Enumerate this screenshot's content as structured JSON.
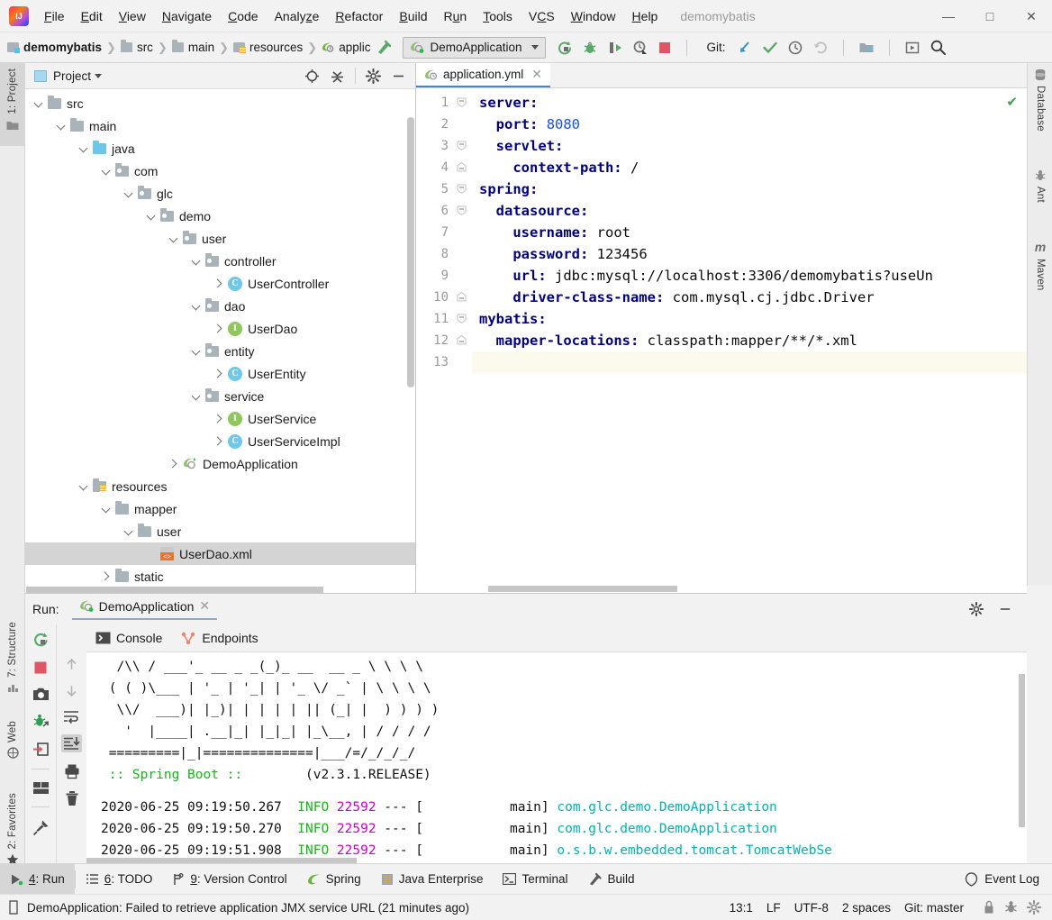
{
  "window": {
    "title": "demomybatis",
    "controls": {
      "minimize": "—",
      "maximize": "□",
      "close": "✕"
    }
  },
  "menu": [
    {
      "label": "File"
    },
    {
      "label": "Edit"
    },
    {
      "label": "View"
    },
    {
      "label": "Navigate"
    },
    {
      "label": "Code"
    },
    {
      "label": "Analyze"
    },
    {
      "label": "Refactor"
    },
    {
      "label": "Build"
    },
    {
      "label": "Run"
    },
    {
      "label": "Tools"
    },
    {
      "label": "VCS"
    },
    {
      "label": "Window"
    },
    {
      "label": "Help"
    }
  ],
  "navbar": {
    "breadcrumbs": [
      {
        "label": "demomybatis",
        "icon": "module-icon"
      },
      {
        "label": "src",
        "icon": "folder-icon"
      },
      {
        "label": "main",
        "icon": "folder-icon"
      },
      {
        "label": "resources",
        "icon": "resources-folder-icon"
      },
      {
        "label": "applic",
        "icon": "spring-file-icon"
      }
    ],
    "run_config": "DemoApplication",
    "git_label": "Git:",
    "actions": [
      "run-button",
      "debug-button",
      "run-with-coverage-button",
      "profile-button",
      "stop-button",
      "update-project-button",
      "commit-button",
      "history-button",
      "rollback-button",
      "project-structure-button",
      "run-anything-button",
      "search-everywhere-button"
    ]
  },
  "left_stripe": [
    {
      "label": "1: Project",
      "active": true
    },
    {
      "label": "7: Structure",
      "active": false
    },
    {
      "label": "Web",
      "active": false
    },
    {
      "label": "2: Favorites",
      "active": false
    }
  ],
  "right_stripe": [
    {
      "label": "Database"
    },
    {
      "label": "Ant"
    },
    {
      "label": "Maven"
    }
  ],
  "project_panel": {
    "title": "Project",
    "actions": [
      "locate-icon",
      "collapse-all-icon",
      "gear-icon",
      "hide-icon"
    ],
    "tree": [
      {
        "label": "src",
        "depth": 1,
        "arrow": "down",
        "icon": "folder",
        "selected": false
      },
      {
        "label": "main",
        "depth": 2,
        "arrow": "down",
        "icon": "folder",
        "selected": false
      },
      {
        "label": "java",
        "depth": 3,
        "arrow": "down",
        "icon": "java",
        "selected": false
      },
      {
        "label": "com",
        "depth": 4,
        "arrow": "down",
        "icon": "pkg",
        "selected": false
      },
      {
        "label": "glc",
        "depth": 5,
        "arrow": "down",
        "icon": "pkg",
        "selected": false
      },
      {
        "label": "demo",
        "depth": 6,
        "arrow": "down",
        "icon": "pkg",
        "selected": false
      },
      {
        "label": "user",
        "depth": 7,
        "arrow": "down",
        "icon": "pkg",
        "selected": false
      },
      {
        "label": "controller",
        "depth": 8,
        "arrow": "down",
        "icon": "pkg",
        "selected": false
      },
      {
        "label": "UserController",
        "depth": 9,
        "arrow": "right",
        "icon": "class",
        "selected": false
      },
      {
        "label": "dao",
        "depth": 8,
        "arrow": "down",
        "icon": "pkg",
        "selected": false
      },
      {
        "label": "UserDao",
        "depth": 9,
        "arrow": "right",
        "icon": "iface",
        "selected": false
      },
      {
        "label": "entity",
        "depth": 8,
        "arrow": "down",
        "icon": "pkg",
        "selected": false
      },
      {
        "label": "UserEntity",
        "depth": 9,
        "arrow": "right",
        "icon": "class",
        "selected": false
      },
      {
        "label": "service",
        "depth": 8,
        "arrow": "down",
        "icon": "pkg",
        "selected": false
      },
      {
        "label": "UserService",
        "depth": 9,
        "arrow": "right",
        "icon": "iface",
        "selected": false
      },
      {
        "label": "UserServiceImpl",
        "depth": 9,
        "arrow": "right",
        "icon": "class",
        "selected": false
      },
      {
        "label": "DemoApplication",
        "depth": 7,
        "arrow": "right",
        "icon": "spring",
        "selected": false
      },
      {
        "label": "resources",
        "depth": 3,
        "arrow": "down",
        "icon": "res",
        "selected": false
      },
      {
        "label": "mapper",
        "depth": 4,
        "arrow": "down",
        "icon": "folder",
        "selected": false
      },
      {
        "label": "user",
        "depth": 5,
        "arrow": "down",
        "icon": "folder",
        "selected": false
      },
      {
        "label": "UserDao.xml",
        "depth": 6,
        "arrow": "none",
        "icon": "xml",
        "selected": true
      },
      {
        "label": "static",
        "depth": 4,
        "arrow": "right",
        "icon": "folder",
        "selected": false
      }
    ]
  },
  "editor": {
    "tab": {
      "label": "application.yml",
      "icon": "spring-file-icon",
      "close": "✕"
    },
    "inspection_status": "✔",
    "lines": [
      {
        "no": "1",
        "fold": "minus-top",
        "indent": 0,
        "key": "server:",
        "value": "",
        "value_type": "none",
        "current": false
      },
      {
        "no": "2",
        "fold": "",
        "indent": 1,
        "key": "port:",
        "value": "8080",
        "value_type": "number",
        "current": false
      },
      {
        "no": "3",
        "fold": "minus-top",
        "indent": 1,
        "key": "servlet:",
        "value": "",
        "value_type": "none",
        "current": false
      },
      {
        "no": "4",
        "fold": "minus-end",
        "indent": 2,
        "key": "context-path:",
        "value": "/",
        "value_type": "text",
        "current": false
      },
      {
        "no": "5",
        "fold": "minus-top",
        "indent": 0,
        "key": "spring:",
        "value": "",
        "value_type": "none",
        "current": false
      },
      {
        "no": "6",
        "fold": "minus-top",
        "indent": 1,
        "key": "datasource:",
        "value": "",
        "value_type": "none",
        "current": false
      },
      {
        "no": "7",
        "fold": "",
        "indent": 2,
        "key": "username:",
        "value": "root",
        "value_type": "text",
        "current": false
      },
      {
        "no": "8",
        "fold": "",
        "indent": 2,
        "key": "password:",
        "value": "123456",
        "value_type": "text",
        "current": false
      },
      {
        "no": "9",
        "fold": "",
        "indent": 2,
        "key": "url:",
        "value": "jdbc:mysql://localhost:3306/demomybatis?useUn",
        "value_type": "text",
        "current": false
      },
      {
        "no": "10",
        "fold": "minus-end",
        "indent": 2,
        "key": "driver-class-name:",
        "value": "com.mysql.cj.jdbc.Driver",
        "value_type": "text",
        "current": false
      },
      {
        "no": "11",
        "fold": "minus-top",
        "indent": 0,
        "key": "mybatis:",
        "value": "",
        "value_type": "none",
        "current": false
      },
      {
        "no": "12",
        "fold": "minus-end",
        "indent": 1,
        "key": "mapper-locations:",
        "value": "classpath:mapper/**/*.xml",
        "value_type": "text",
        "current": false
      },
      {
        "no": "13",
        "fold": "",
        "indent": 0,
        "key": "",
        "value": "",
        "value_type": "none",
        "current": true
      }
    ]
  },
  "run_window": {
    "label": "Run:",
    "tab": "DemoApplication",
    "tab_close": "✕",
    "header_actions": [
      "gear-icon",
      "hide-icon"
    ],
    "left_actions": [
      "rerun-icon",
      "stop-icon",
      "camera-icon",
      "thread-dump-icon",
      "export-icon",
      "layout-icon",
      "pin-icon"
    ],
    "secondary_actions": [
      "up-arrow-icon",
      "down-arrow-icon",
      "soft-wrap-icon",
      "scroll-to-end-icon",
      "print-icon",
      "trash-icon"
    ],
    "tabs": [
      {
        "label": "Console",
        "icon": "console-icon",
        "active": true
      },
      {
        "label": "Endpoints",
        "icon": "endpoints-icon",
        "active": false
      }
    ],
    "console": {
      "banner": [
        "  /\\\\ / ___'_ __ _ _(_)_ __  __ _ \\ \\ \\ \\",
        " ( ( )\\___ | '_ | '_| | '_ \\/ _` | \\ \\ \\ \\",
        "  \\\\/  ___)| |_)| | | | | || (_| |  ) ) ) )",
        "   '  |____| .__|_| |_|_| |_\\__, | / / / /",
        " =========|_|==============|___/=/_/_/_/"
      ],
      "banner_footer_left": " :: Spring Boot :: ",
      "banner_footer_right": "       (v2.3.1.RELEASE)",
      "logs": [
        {
          "ts": "2020-06-25 09:19:50.267",
          "level": "INFO",
          "pid": "22592",
          "dash": "--- [",
          "thread": "           main]",
          "logger": "com.glc.demo.DemoApplication"
        },
        {
          "ts": "2020-06-25 09:19:50.270",
          "level": "INFO",
          "pid": "22592",
          "dash": "--- [",
          "thread": "           main]",
          "logger": "com.glc.demo.DemoApplication"
        },
        {
          "ts": "2020-06-25 09:19:51.908",
          "level": "INFO",
          "pid": "22592",
          "dash": "--- [",
          "thread": "           main]",
          "logger": "o.s.b.w.embedded.tomcat.TomcatWebSe"
        }
      ]
    }
  },
  "bottom_tabs": [
    {
      "label": "4: Run",
      "num": "4",
      "rest": ": Run",
      "icon": "run-icon",
      "active": true
    },
    {
      "label": "6: TODO",
      "num": "6",
      "rest": ": TODO",
      "icon": "todo-icon",
      "active": false
    },
    {
      "label": "9: Version Control",
      "num": "9",
      "rest": ": Version Control",
      "icon": "vcs-icon",
      "active": false
    },
    {
      "label": "Spring",
      "num": "",
      "rest": "Spring",
      "icon": "spring-leaf-icon",
      "active": false
    },
    {
      "label": "Java Enterprise",
      "num": "",
      "rest": "Java Enterprise",
      "icon": "java-ee-icon",
      "active": false
    },
    {
      "label": "Terminal",
      "num": "",
      "rest": "Terminal",
      "icon": "terminal-icon",
      "active": false
    },
    {
      "label": "Build",
      "num": "",
      "rest": "Build",
      "icon": "build-hammer-icon",
      "active": false
    }
  ],
  "event_log": {
    "label": "Event Log",
    "icon": "balloon-icon"
  },
  "statusbar": {
    "message": "DemoApplication: Failed to retrieve application JMX service URL (21 minutes ago)",
    "caret": "13:1",
    "line_separator": "LF",
    "encoding": "UTF-8",
    "indent": "2 spaces",
    "branch": "Git: master",
    "icons": [
      "lock-icon",
      "inspector-icon",
      "settings-icon"
    ]
  },
  "colors": {
    "accent_blue": "#4682d6",
    "key_navy": "#000080",
    "number_blue": "#1750eb",
    "console_green": "#14b814",
    "console_magenta": "#cc00cc",
    "console_cyan": "#00b3b3",
    "selection_gray": "#d4d4d4",
    "current_line": "#fcfaed"
  }
}
